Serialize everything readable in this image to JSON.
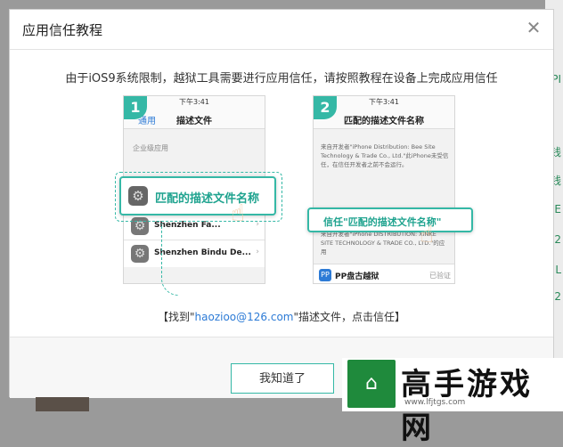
{
  "background": {
    "right_edge_texts": [
      "PI",
      "钱",
      "钱",
      "GE",
      "2",
      "L",
      "2"
    ]
  },
  "dialog": {
    "title": "应用信任教程",
    "close_icon": "close-icon",
    "instruction": "由于iOS9系统限制，越狱工具需要进行应用信任，请按照教程在设备上完成应用信任",
    "caption_prefix": "【找到\"",
    "caption_email": "haozioo@126.com",
    "caption_suffix": "\"描述文件，点击信任】",
    "ok_button": "我知道了"
  },
  "phone1": {
    "step": "1",
    "time": "下午3:41",
    "back": "通用",
    "title": "描述文件",
    "section": "企业级应用",
    "highlight": "匹配的描述文件名称",
    "rows": [
      "Shenzhen Fa...",
      "Shenzhen Bindu De..."
    ]
  },
  "phone2": {
    "step": "2",
    "time": "下午3:41",
    "title": "匹配的描述文件名称",
    "cert_text": "来自开发者\"iPhone Distribution: Bee Site Technology & Trade Co., Ltd.\"此iPhone未受信任，在信任开发者之前不会运行。",
    "cert_text2": "来自开发者\"iPhone DISTRIBUTION: XINKE SITE TECHNOLOGY & TRADE CO., LTD.\"的应用",
    "trust_label": "信任\"匹配的描述文件名称\"",
    "app_name": "PP盘古越狱",
    "verified": "已验证"
  },
  "watermark": {
    "text": "高手游戏网",
    "url": "www.lfjtgs.com"
  },
  "colors": {
    "accent": "#35b8a6",
    "link": "#2d7bd6"
  }
}
